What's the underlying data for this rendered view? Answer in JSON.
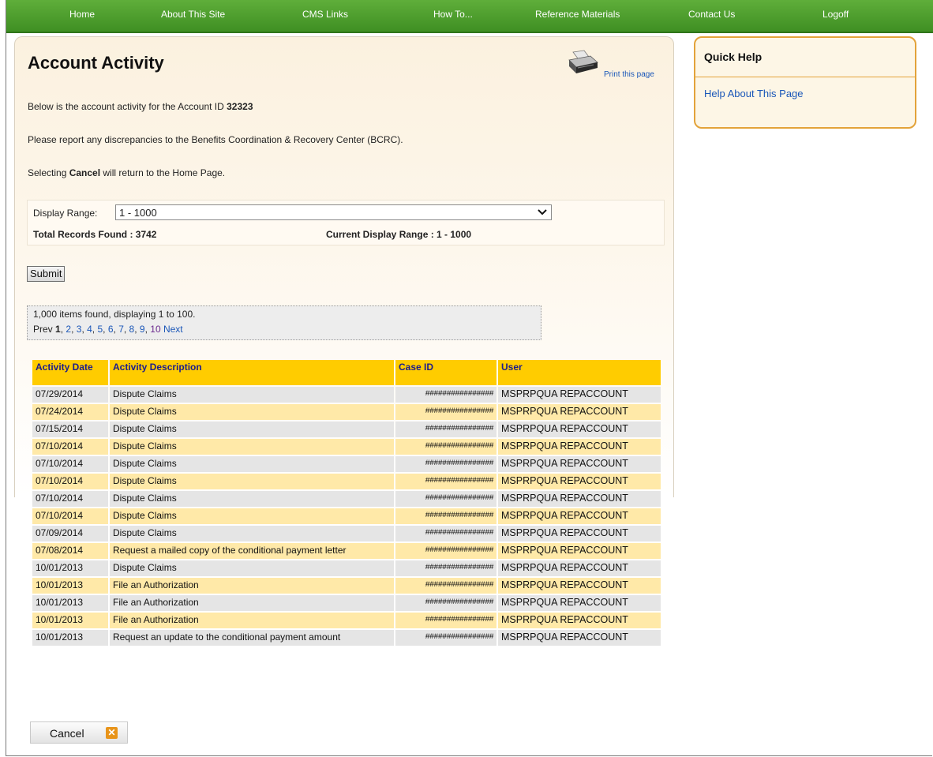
{
  "nav": [
    {
      "label": "Home"
    },
    {
      "label": "About This Site"
    },
    {
      "label": "CMS Links"
    },
    {
      "label": "How To..."
    },
    {
      "label": "Reference Materials"
    },
    {
      "label": "Contact Us"
    },
    {
      "label": "Logoff"
    }
  ],
  "page": {
    "title": "Account Activity",
    "print_label": "Print this page",
    "intro_prefix": "Below is the account activity for the Account ID ",
    "account_id": "32323",
    "discrepancy_text": "Please report any discrepancies to the Benefits Coordination & Recovery Center (BCRC).",
    "cancel_prefix": "Selecting ",
    "cancel_bold": "Cancel",
    "cancel_suffix": " will return to the Home Page."
  },
  "range": {
    "label": "Display Range:",
    "selected": "1 - 1000",
    "total": "Total Records Found : 3742",
    "current": "Current Display Range : 1 - 1000"
  },
  "submit_label": "Submit",
  "pager": {
    "found": "1,000 items found, displaying 1 to 100.",
    "prev": "Prev",
    "current": "1",
    "pages": [
      "2",
      "3",
      "4",
      "5",
      "6",
      "7",
      "8",
      "9",
      "10"
    ],
    "next": "Next"
  },
  "table": {
    "headers": [
      "Activity Date",
      "Activity Description",
      "Case ID",
      "User"
    ],
    "rows": [
      {
        "date": "07/29/2014",
        "desc": "Dispute Claims",
        "case": "################",
        "user": "MSPRPQUA  REPACCOUNT"
      },
      {
        "date": "07/24/2014",
        "desc": "Dispute Claims",
        "case": "################",
        "user": "MSPRPQUA  REPACCOUNT"
      },
      {
        "date": "07/15/2014",
        "desc": "Dispute Claims",
        "case": "################",
        "user": "MSPRPQUA  REPACCOUNT"
      },
      {
        "date": "07/10/2014",
        "desc": "Dispute Claims",
        "case": "################",
        "user": "MSPRPQUA  REPACCOUNT"
      },
      {
        "date": "07/10/2014",
        "desc": "Dispute Claims",
        "case": "################",
        "user": "MSPRPQUA  REPACCOUNT"
      },
      {
        "date": "07/10/2014",
        "desc": "Dispute Claims",
        "case": "################",
        "user": "MSPRPQUA  REPACCOUNT"
      },
      {
        "date": "07/10/2014",
        "desc": "Dispute Claims",
        "case": "################",
        "user": "MSPRPQUA  REPACCOUNT"
      },
      {
        "date": "07/10/2014",
        "desc": "Dispute Claims",
        "case": "################",
        "user": "MSPRPQUA  REPACCOUNT"
      },
      {
        "date": "07/09/2014",
        "desc": "Dispute Claims",
        "case": "################",
        "user": "MSPRPQUA  REPACCOUNT"
      },
      {
        "date": "07/08/2014",
        "desc": "Request a mailed copy of the conditional payment letter",
        "case": "################",
        "user": "MSPRPQUA  REPACCOUNT"
      },
      {
        "date": "10/01/2013",
        "desc": "Dispute Claims",
        "case": "################",
        "user": "MSPRPQUA  REPACCOUNT"
      },
      {
        "date": "10/01/2013",
        "desc": "File an Authorization",
        "case": "################",
        "user": "MSPRPQUA  REPACCOUNT"
      },
      {
        "date": "10/01/2013",
        "desc": "File an Authorization",
        "case": "################",
        "user": "MSPRPQUA  REPACCOUNT"
      },
      {
        "date": "10/01/2013",
        "desc": "File an Authorization",
        "case": "################",
        "user": "MSPRPQUA  REPACCOUNT"
      },
      {
        "date": "10/01/2013",
        "desc": "Request an update to the conditional payment amount",
        "case": "################",
        "user": "MSPRPQUA  REPACCOUNT"
      }
    ]
  },
  "cancel_button": "Cancel",
  "quick_help": {
    "title": "Quick Help",
    "link": "Help About This Page"
  },
  "colors": {
    "nav_green": "#4a9c2b",
    "header_yellow": "#ffcc00",
    "row_yellow": "#ffe9a8",
    "row_gray": "#e5e5e5",
    "link_blue": "#1a56b8",
    "accent_orange": "#e3a33a"
  },
  "icons": {
    "print": "printer-icon",
    "cancel": "close-icon"
  }
}
